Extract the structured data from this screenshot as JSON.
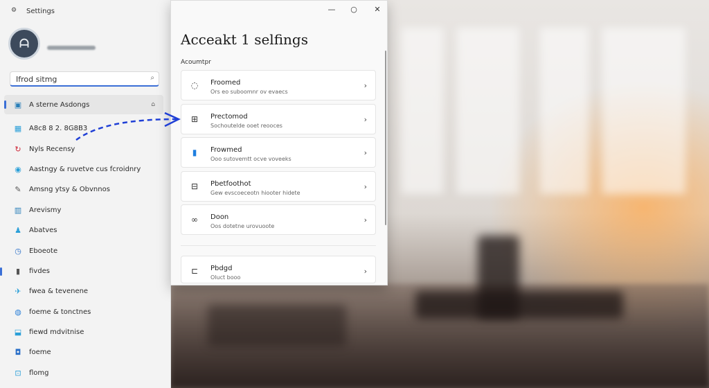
{
  "app": {
    "icon": "settings-icon",
    "title": "Settings"
  },
  "titlebar": {
    "minimize": "—",
    "maximize": "○",
    "close": "✕"
  },
  "search": {
    "value": "Ifrod sitmg",
    "icon": "search-icon"
  },
  "sidebar": {
    "items": [
      {
        "label": "A sterne Asdongs",
        "icon": "home-icon",
        "trail": "⌂",
        "active": true
      },
      {
        "label": "A8c8 8 2. 8G8B3",
        "icon": "system-icon",
        "active": false
      },
      {
        "label": "Nyls Recensy",
        "icon": "bluetooth-icon",
        "active": false
      },
      {
        "label": "Aastngy & ruvetve cus fcroidnry",
        "icon": "network-icon",
        "active": false
      },
      {
        "label": "Amsng ytsy & Obvnnos",
        "icon": "personalization-icon",
        "active": false
      },
      {
        "label": "Arevismy",
        "icon": "apps-icon",
        "active": false
      },
      {
        "label": "Abatves",
        "icon": "accounts-icon",
        "active": false
      },
      {
        "label": "Eboeote",
        "icon": "time-icon",
        "active": false
      },
      {
        "label": "fivdes",
        "icon": "gaming-icon",
        "active": false
      },
      {
        "label": "fwea & tevenene",
        "icon": "accessibility-icon",
        "active": false
      },
      {
        "label": "foeme & tonctnes",
        "icon": "privacy-icon",
        "active": false
      },
      {
        "label": "fiewd mdvitnise",
        "icon": "update-icon",
        "active": false
      },
      {
        "label": "foeme",
        "icon": "windows-icon",
        "active": false
      },
      {
        "label": "flomg",
        "icon": "help-icon",
        "active": false
      }
    ]
  },
  "main": {
    "title": "Acceakt 1 selfings",
    "section": "Acoumtpr",
    "cards": [
      {
        "title": "Froomed",
        "sub": "Ors eo suboomnr ov evaecs",
        "icon": "info-icon"
      },
      {
        "title": "Prectomod",
        "sub": "Sochoutelde ooet reooces",
        "icon": "sign-in-icon"
      },
      {
        "title": "Frowmed",
        "sub": "Ooo sutovemtt ocve voveeks",
        "icon": "email-icon"
      },
      {
        "title": "Pbetfoothot",
        "sub": "Gew evscoeceotn hiooter hidete",
        "icon": "family-icon"
      },
      {
        "title": "Doon",
        "sub": "Oos dotetne urovuoote",
        "icon": "sync-icon"
      },
      {
        "title": "Pbdgd",
        "sub": "Oluct booo",
        "icon": "devices-icon"
      }
    ]
  },
  "colors": {
    "accent": "#3b6fd6",
    "arrow": "#1f3fd6"
  }
}
